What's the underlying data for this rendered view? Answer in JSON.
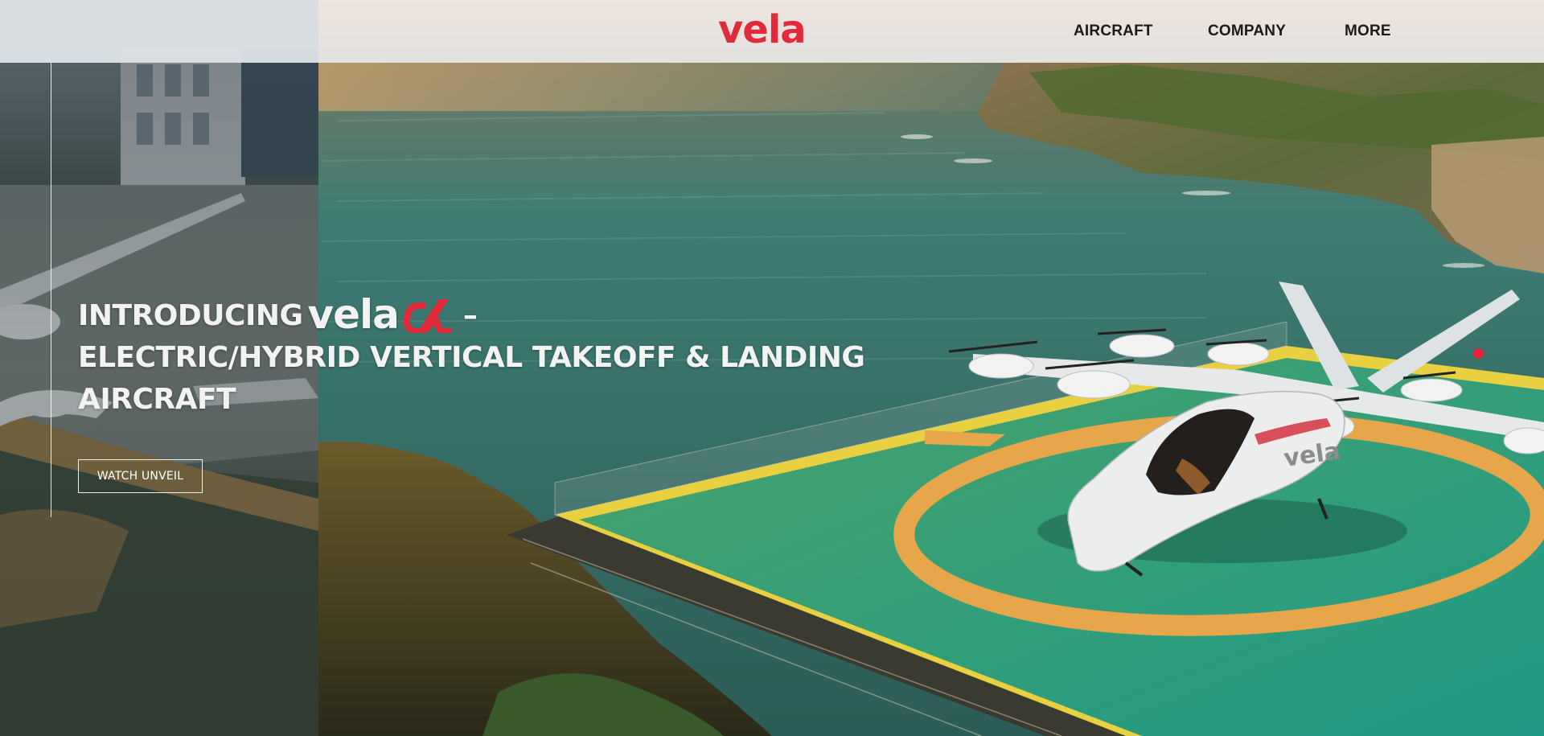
{
  "header": {
    "logo_text": "vela",
    "nav": [
      {
        "label": "AIRCRAFT"
      },
      {
        "label": "COMPANY"
      },
      {
        "label": "MORE"
      }
    ]
  },
  "hero": {
    "intro_label": "INTRODUCING",
    "brand": "vela",
    "brand_suffix_icon": "alpha-icon",
    "dash": "–",
    "line2": "ELECTRIC/HYBRID VERTICAL TAKEOFF & LANDING",
    "line3": "AIRCRAFT",
    "cta_label": "WATCH UNVEIL",
    "aircraft_livery": "vela"
  },
  "colors": {
    "brand_red": "#e12a3a",
    "nav_text": "#1a1a1a",
    "header_bg": "#f2f0f0",
    "sea": "#2f6f6a",
    "helipad_green": "#2e9c7a",
    "helipad_ring": "#e8a64a",
    "helipad_edge": "#f2d44a"
  }
}
